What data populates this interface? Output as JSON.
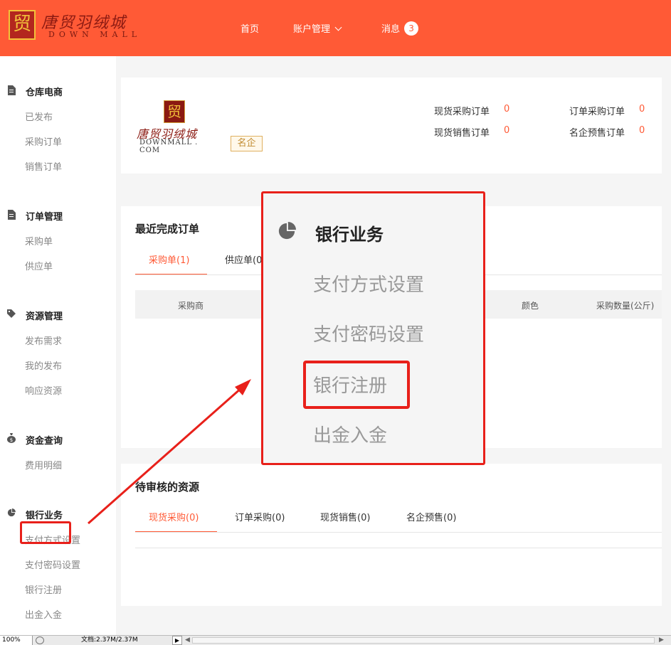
{
  "header": {
    "logo_cn": "唐贸羽绒城",
    "logo_en": "DOWN MALL",
    "logo_seal": "贸",
    "nav": [
      {
        "label": "首页"
      },
      {
        "label": "账户管理"
      },
      {
        "label": "消息",
        "badge": "3"
      }
    ],
    "bg_color": "#ff5a36"
  },
  "sidebar": {
    "groups": [
      {
        "title": "仓库电商",
        "icon": "document-icon",
        "items": [
          "已发布",
          "采购订单",
          "销售订单"
        ]
      },
      {
        "title": "订单管理",
        "icon": "document-icon",
        "items": [
          "采购单",
          "供应单"
        ]
      },
      {
        "title": "资源管理",
        "icon": "tag-icon",
        "items": [
          "发布需求",
          "我的发布",
          "响应资源"
        ]
      },
      {
        "title": "资金查询",
        "icon": "money-bag-icon",
        "items": [
          "费用明细"
        ]
      },
      {
        "title": "银行业务",
        "icon": "pie-chart-icon",
        "items": [
          "支付方式设置",
          "支付密码设置",
          "银行注册",
          "出金入金"
        ]
      }
    ]
  },
  "profile": {
    "company_seal": "贸",
    "company_cn": "唐贸羽绒城",
    "company_en": "DOWNMALL . COM",
    "badge": "名企",
    "stats": [
      {
        "label": "现货采购订单",
        "value": "0"
      },
      {
        "label": "订单采购订单",
        "value": "0"
      },
      {
        "label": "现货销售订单",
        "value": "0"
      },
      {
        "label": "名企预售订单",
        "value": "0"
      }
    ]
  },
  "recent_orders": {
    "title": "最近完成订单",
    "tabs": [
      "采购单(1)",
      "供应单(0"
    ],
    "columns": [
      "采购商",
      "颜色",
      "采购数量(公斤)"
    ]
  },
  "pending": {
    "title": "待审核的资源",
    "tabs": [
      "现货采购(0)",
      "订单采购(0)",
      "现货销售(0)",
      "名企预售(0)"
    ]
  },
  "zoom_callout": {
    "title": "银行业务",
    "items": [
      "支付方式设置",
      "支付密码设置",
      "银行注册",
      "出金入金"
    ],
    "highlight_color": "#e8201a"
  },
  "statusbar": {
    "zoom": "100%",
    "doc": "文档:2.37M/2.37M",
    "play": "▶",
    "left": "◀",
    "right": "▶"
  }
}
